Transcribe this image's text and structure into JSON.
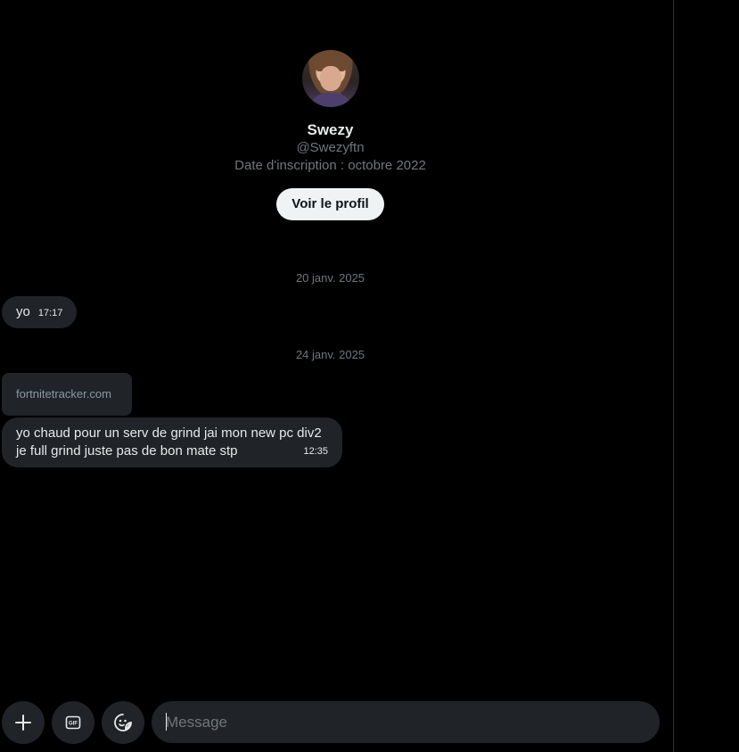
{
  "profile": {
    "name": "Swezy",
    "handle": "@Swezyftn",
    "joined": "Date d'inscription : octobre 2022",
    "view_profile_label": "Voir le profil"
  },
  "messages": {
    "date_1": "20 janv. 2025",
    "msg_1_text": "yo",
    "msg_1_time": "17:17",
    "date_2": "24 janv. 2025",
    "link_card_domain": "fortnitetracker.com",
    "msg_2_line_1": "yo chaud pour un serv de grind jai mon new pc div2",
    "msg_2_line_2": "je full grind juste pas de bon mate stp",
    "msg_2_time": "12:35"
  },
  "composer": {
    "placeholder": "Message",
    "add_icon": "plus-icon",
    "gif_icon": "gif-icon",
    "emoji_icon": "emoji-icon"
  },
  "colors": {
    "background": "#000000",
    "bubble": "#202327",
    "muted_text": "#71767b",
    "primary_text": "#e7e9ea",
    "button_bg": "#eff3f4"
  }
}
